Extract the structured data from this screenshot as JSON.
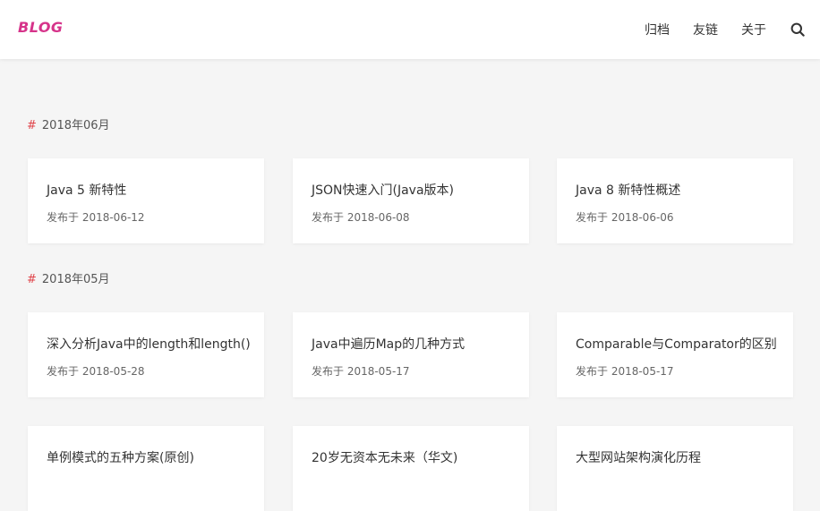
{
  "header": {
    "logo": "BLOG",
    "nav": [
      "归档",
      "友链",
      "关于"
    ],
    "search_icon": "search-icon"
  },
  "sections": [
    {
      "title": "2018年06月",
      "posts": [
        {
          "title": "Java 5 新特性",
          "date": "发布于 2018-06-12"
        },
        {
          "title": "JSON快速入门(Java版本)",
          "date": "发布于 2018-06-08"
        },
        {
          "title": "Java 8 新特性概述",
          "date": "发布于 2018-06-06"
        }
      ]
    },
    {
      "title": "2018年05月",
      "posts": [
        {
          "title": "深入分析Java中的length和length()",
          "date": "发布于 2018-05-28"
        },
        {
          "title": "Java中遍历Map的几种方式",
          "date": "发布于 2018-05-17"
        },
        {
          "title": "Comparable与Comparator的区别",
          "date": "发布于 2018-05-17"
        },
        {
          "title": "单例模式的五种方案(原创)",
          "date": ""
        },
        {
          "title": "20岁无资本无未来（华文)",
          "date": ""
        },
        {
          "title": "大型网站架构演化历程",
          "date": ""
        }
      ]
    }
  ],
  "colors": {
    "logo": "#d6338a",
    "hash": "#e0444a",
    "background": "#f5f5f5"
  }
}
